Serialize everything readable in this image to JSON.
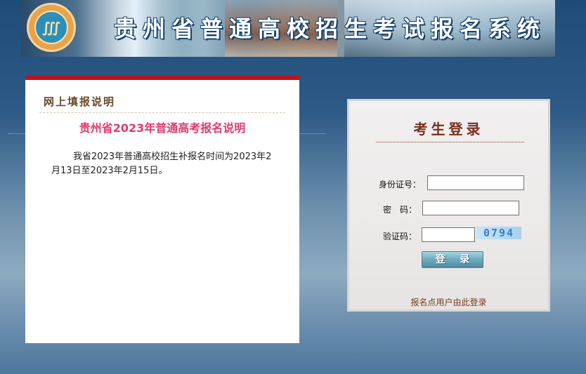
{
  "banner": {
    "title": "贵州省普通高校招生考试报名系统",
    "logo_icon": "emblem-icon"
  },
  "notice": {
    "heading": "网上填报说明",
    "title": "贵州省2023年普通高考报名说明",
    "body": "我省2023年普通高校招生补报名时间为2023年2月13日至2023年2月15日。"
  },
  "login": {
    "title": "考生登录",
    "id_label": "身份证号：",
    "id_value": "",
    "password_label": "密　码：",
    "password_value": "",
    "captcha_label": "验证码：",
    "captcha_value": "",
    "captcha_text": "0794",
    "submit_label": "登 录",
    "site_link": "报名点用户由此登录"
  },
  "colors": {
    "notice_accent": "#c0131b",
    "notice_title": "#e23a6d",
    "login_title": "#7a2e1e"
  }
}
